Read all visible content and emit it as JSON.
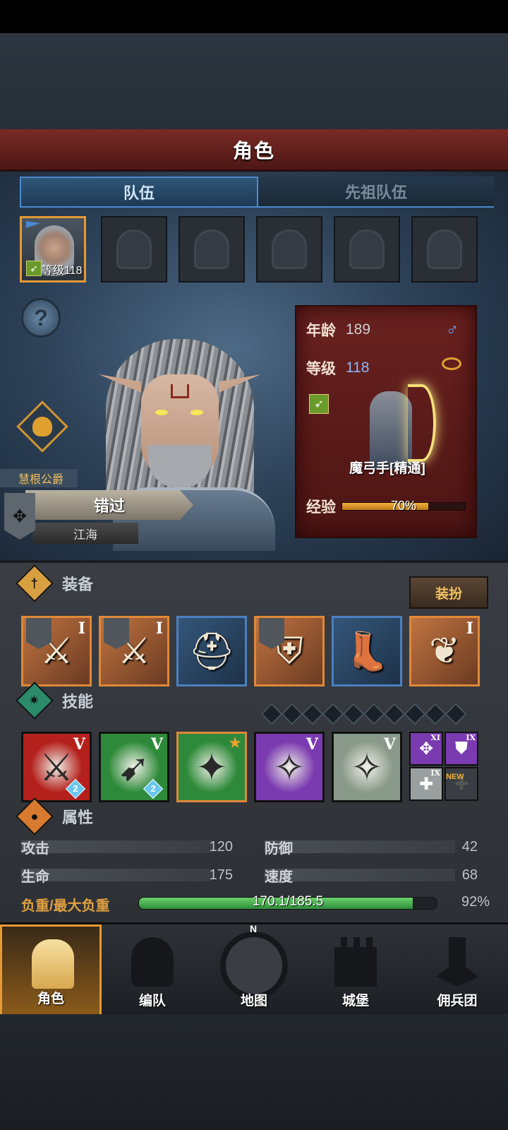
{
  "header": {
    "title": "角色"
  },
  "tabs": [
    {
      "label": "队伍",
      "active": true
    },
    {
      "label": "先祖队伍",
      "active": false
    }
  ],
  "party_slot": {
    "level_text": "等级118"
  },
  "hero": {
    "title": "慧根公爵",
    "name": "错过",
    "subname": "江海"
  },
  "info_card": {
    "age_label": "年龄",
    "age": "189",
    "level_label": "等级",
    "level": "118",
    "gender_icon": "male-icon",
    "class_name": "魔弓手[精通]",
    "exp_label": "经验",
    "exp_text": "70%",
    "exp_fraction": 0.7
  },
  "equipment": {
    "title": "装备",
    "costume_button": "装扮",
    "items": [
      {
        "icon": "blade-icon",
        "tier": "I",
        "rarity": "orange"
      },
      {
        "icon": "blade-icon",
        "tier": "I",
        "rarity": "orange"
      },
      {
        "icon": "helmet-icon",
        "tier": "",
        "rarity": "blue"
      },
      {
        "icon": "armor-icon",
        "tier": "",
        "rarity": "orange"
      },
      {
        "icon": "boots-icon",
        "tier": "",
        "rarity": "blue"
      },
      {
        "icon": "phoenix-emblem-icon",
        "tier": "I",
        "rarity": "orange"
      }
    ]
  },
  "skills": {
    "title": "技能",
    "items": [
      {
        "icon": "sword-strike-icon",
        "tier": "V",
        "badge": "2",
        "color": "#b4201c"
      },
      {
        "icon": "bow-shot-icon",
        "tier": "V",
        "badge": "2",
        "color": "#2e8a3a"
      },
      {
        "icon": "crystal-arrow-icon",
        "tier": "",
        "badge": "",
        "color": "#2e8a3a"
      },
      {
        "icon": "crystal-fist-icon",
        "tier": "V",
        "badge": "",
        "color": "#7a3ab0"
      },
      {
        "icon": "crystal-fist-icon",
        "tier": "V",
        "badge": "",
        "color": "#8a9a8a"
      }
    ],
    "passives": [
      {
        "icon": "compass-rune-icon",
        "tier": "XI"
      },
      {
        "icon": "shield-icon",
        "tier": "IX"
      },
      {
        "icon": "plus-cross-icon",
        "tier": "IX"
      },
      {
        "icon": "empty-cross-icon",
        "tier": ""
      }
    ],
    "new_tag": "NEW"
  },
  "attributes": {
    "title": "属性",
    "attack_label": "攻击",
    "attack": "120",
    "defense_label": "防御",
    "defense": "42",
    "hp_label": "生命",
    "hp": "175",
    "speed_label": "速度",
    "speed": "68",
    "weight_label": "负重/最大负重",
    "weight_text": "170.1/185.5",
    "weight_pct": "92%",
    "weight_fraction": 0.92
  },
  "navbar": [
    {
      "label": "角色",
      "icon": "knight-icon",
      "active": true
    },
    {
      "label": "编队",
      "icon": "helmet-squad-icon",
      "active": false
    },
    {
      "label": "地图",
      "icon": "compass-map-icon",
      "active": false
    },
    {
      "label": "城堡",
      "icon": "castle-icon",
      "active": false
    },
    {
      "label": "佣兵团",
      "icon": "mercenary-banner-icon",
      "active": false
    }
  ],
  "compass_letter": "N"
}
